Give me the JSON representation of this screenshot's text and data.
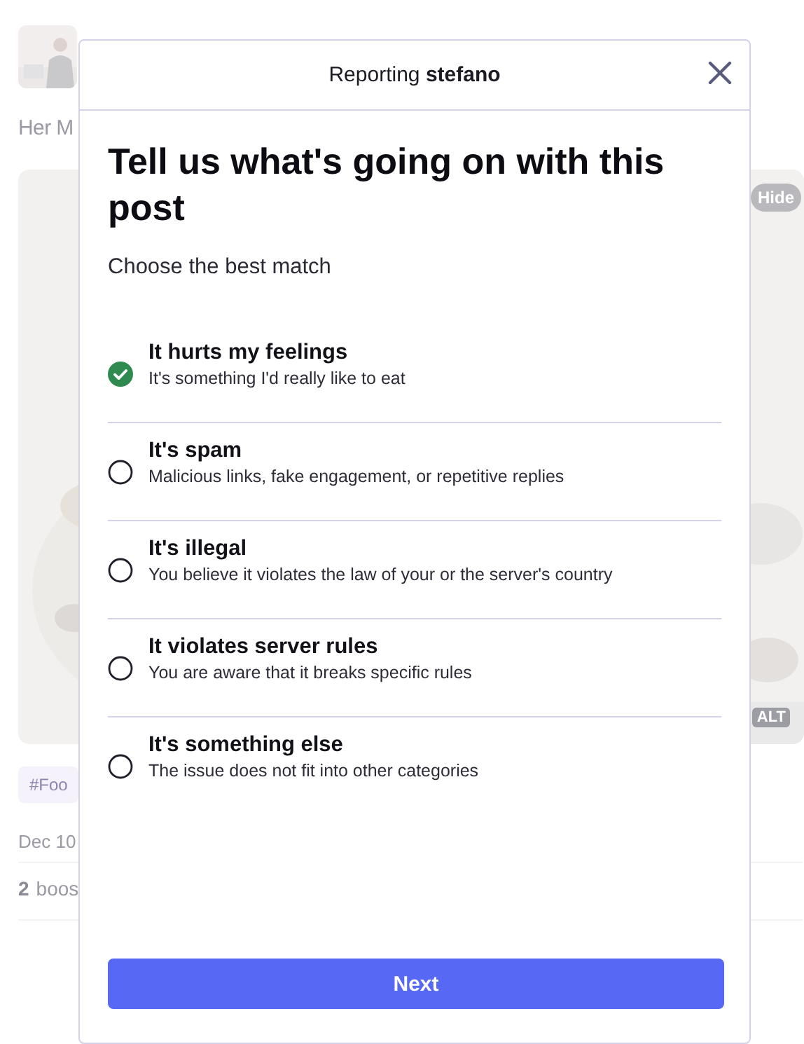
{
  "post": {
    "text": "Her M",
    "media": {
      "kind": "picture",
      "hide_label": "Hide",
      "alt_badge": "ALT"
    },
    "tag": "#Foo",
    "date": "Dec 10",
    "boosts_count": "2",
    "boosts_label": "boos"
  },
  "dialog": {
    "title_prefix": "Reporting",
    "title_user": "stefano",
    "heading": "Tell us what's going on with this post",
    "subheading": "Choose the best match",
    "options": [
      {
        "label": "It hurts my feelings",
        "description": "It's something I'd really like to eat",
        "selected": true
      },
      {
        "label": "It's spam",
        "description": "Malicious links, fake engagement, or repetitive replies",
        "selected": false
      },
      {
        "label": "It's illegal",
        "description": "You believe it violates the law of your or the server's country",
        "selected": false
      },
      {
        "label": "It violates server rules",
        "description": "You are aware that it breaks specific rules",
        "selected": false
      },
      {
        "label": "It's something else",
        "description": "The issue does not fit into other categories",
        "selected": false
      }
    ],
    "next_button": "Next"
  }
}
